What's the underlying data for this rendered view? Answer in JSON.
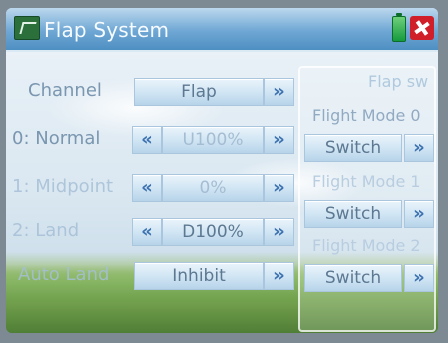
{
  "title": "Flap System",
  "left_rows": [
    {
      "id": "channel",
      "label": "Channel",
      "value": "Flap"
    },
    {
      "id": "normal",
      "label": "0: Normal",
      "value": "U100%"
    },
    {
      "id": "midpoint",
      "label": "1: Midpoint",
      "value": "0%"
    },
    {
      "id": "land",
      "label": "2: Land",
      "value": "D100%"
    },
    {
      "id": "auto_land",
      "label": "Auto Land",
      "value": "Inhibit"
    }
  ],
  "arrows": {
    "left": "«",
    "right": "»"
  },
  "right_panel": {
    "title": "Flap sw",
    "items": [
      {
        "label": "Flight Mode 0",
        "button": "Switch"
      },
      {
        "label": "Flight Mode 1",
        "button": "Switch"
      },
      {
        "label": "Flight Mode 2",
        "button": "Switch"
      }
    ]
  },
  "icons": [
    "aircraft-icon",
    "battery-icon",
    "flap-system-icon"
  ],
  "colors": {
    "title_bar": "#6fa7d4",
    "label_text": "#7a96b0",
    "arrow": "#3d72b0",
    "aircraft_icon": "#d11f2a",
    "battery": "#159a3e"
  }
}
